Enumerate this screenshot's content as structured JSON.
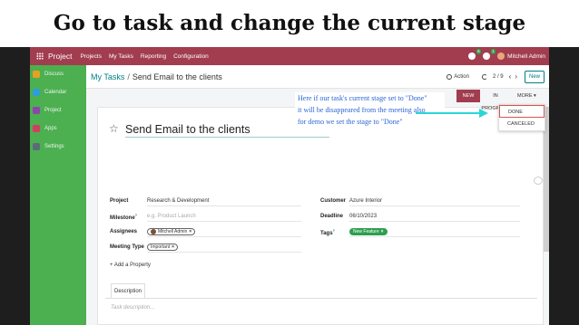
{
  "slide_title": "Go to task and change the current stage",
  "navbar": {
    "app_name": "Project",
    "menu": [
      "Projects",
      "My Tasks",
      "Reporting",
      "Configuration"
    ],
    "chat_badge": "6",
    "activity_badge": "1",
    "user_name": "Mitchell Admin"
  },
  "sidebar": {
    "items": [
      {
        "label": "Discuss",
        "color": "#e8a020"
      },
      {
        "label": "Calendar",
        "color": "#2e9ed8"
      },
      {
        "label": "Project",
        "color": "#8e44ad"
      },
      {
        "label": "Apps",
        "color": "#d63c5e"
      },
      {
        "label": "Settings",
        "color": "#5b6b7c"
      }
    ]
  },
  "breadcrumb": {
    "parent": "My Tasks",
    "separator": "/",
    "current": "Send Email to the clients"
  },
  "control": {
    "action_label": "Action",
    "pager": "2 / 9",
    "new_label": "New"
  },
  "stages": {
    "new": "NEW",
    "in_progress": "IN PROGRESS",
    "more": "MORE ▾",
    "dropdown": [
      "DONE",
      "CANCELED"
    ]
  },
  "annotation": [
    "Here if our task's current stage set to \"Done\"",
    "it will be disappeared from the meeting also",
    "for demo we set the stage to \"Done\""
  ],
  "form": {
    "title": "Send Email to the clients",
    "project_label": "Project",
    "project_value": "Research & Development",
    "milestone_label": "Milestone",
    "milestone_placeholder": "e.g. Product Launch",
    "assignees_label": "Assignees",
    "assignee": "Mitchell Admin",
    "meeting_type_label": "Meeting Type",
    "meeting_type": "Important",
    "customer_label": "Customer",
    "customer_value": "Azure Interior",
    "deadline_label": "Deadline",
    "deadline_value": "06/10/2023",
    "tags_label": "Tags",
    "tag": "New Feature",
    "add_property": "+ Add a Property",
    "description_tab": "Description",
    "description_placeholder": "Task description..."
  },
  "colors": {
    "brand": "#a13d4f",
    "accent": "#017e84",
    "sidebar_green": "#4caf50",
    "annotation": "#2b66d6",
    "arrow": "#2bd6d6"
  }
}
